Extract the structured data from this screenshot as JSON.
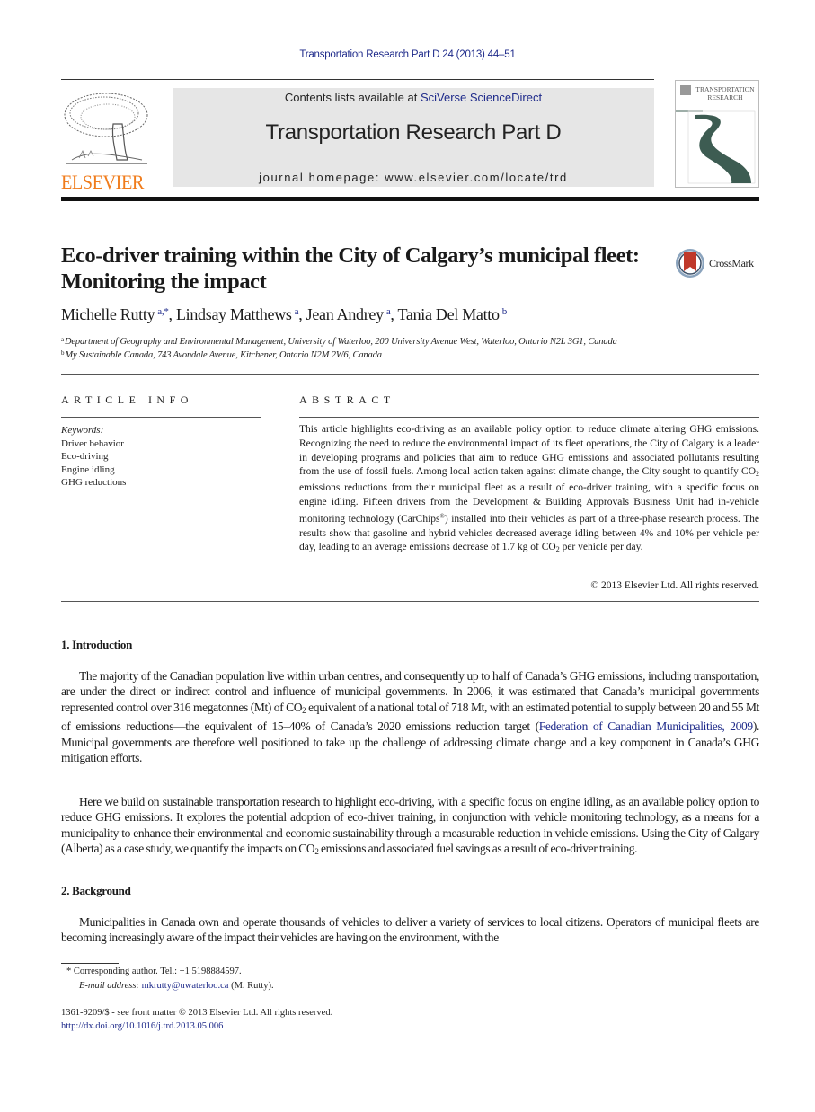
{
  "running_head": "Transportation Research Part D 24 (2013) 44–51",
  "masthead": {
    "publisher_logo_text": "ELSEVIER",
    "contents_prefix": "Contents lists available at ",
    "contents_link": "SciVerse ScienceDirect",
    "journal_title": "Transportation Research Part D",
    "homepage": "journal homepage: www.elsevier.com/locate/trd",
    "cover_title_line1": "TRANSPORTATION",
    "cover_title_line2": "RESEARCH"
  },
  "colors": {
    "link": "#1e2a8a",
    "elsevier_orange": "#f07c1c",
    "masthead_gray": "#e6e6e6",
    "cover_road": "#3d5c52"
  },
  "article": {
    "title_line1": "Eco-driver training within the City of Calgary’s municipal fleet:",
    "title_line2": "Monitoring the impact",
    "crossmark_label": "CrossMark",
    "authors": [
      {
        "name": "Michelle Rutty",
        "sup": "a,*"
      },
      {
        "name": "Lindsay Matthews",
        "sup": "a"
      },
      {
        "name": "Jean Andrey",
        "sup": "a"
      },
      {
        "name": "Tania Del Matto",
        "sup": "b"
      }
    ],
    "affiliations": [
      {
        "key": "a",
        "text": "Department of Geography and Environmental Management, University of Waterloo, 200 University Avenue West, Waterloo, Ontario N2L 3G1, Canada"
      },
      {
        "key": "b",
        "text": "My Sustainable Canada, 743 Avondale Avenue, Kitchener, Ontario N2M 2W6, Canada"
      }
    ]
  },
  "article_info": {
    "label": "ARTICLE INFO",
    "keywords_label": "Keywords:",
    "keywords": [
      "Driver behavior",
      "Eco-driving",
      "Engine idling",
      "GHG reductions"
    ]
  },
  "abstract": {
    "label": "ABSTRACT",
    "part1": "This article highlights eco-driving as an available policy option to reduce climate altering GHG emissions. Recognizing the need to reduce the environmental impact of its fleet operations, the City of Calgary is a leader in developing programs and policies that aim to reduce GHG emissions and associated pollutants resulting from the use of fossil fuels. Among local action taken against climate change, the City sought to quantify CO",
    "part2": " emissions reductions from their municipal fleet as a result of eco-driver training, with a specific focus on engine idling. Fifteen drivers from the Development & Building Approvals Business Unit had in-vehicle monitoring technology (CarChips",
    "part3": ") installed into their vehicles as part of a three-phase research process. The results show that gasoline and hybrid vehicles decreased average idling between 4% and 10% per vehicle per day, leading to an average emissions decrease of 1.7 kg of CO",
    "part4": " per vehicle per day.",
    "sub": "2",
    "reg": "®",
    "copyright": "© 2013 Elsevier Ltd. All rights reserved."
  },
  "sections": {
    "intro_heading": "1. Introduction",
    "intro_p1_a": "The majority of the Canadian population live within urban centres, and consequently up to half of Canada’s GHG emissions, including transportation, are under the direct or indirect control and influence of municipal governments. In 2006, it was estimated that Canada’s municipal governments represented control over 316 megatonnes (Mt) of CO",
    "intro_p1_b": " equivalent of a national total of 718 Mt, with an estimated potential to supply between 20 and 55 Mt of emissions reductions—the equivalent of 15–40% of Canada’s 2020 emissions reduction target (",
    "intro_p1_cite": "Federation of Canadian Municipalities, 2009",
    "intro_p1_c": "). Municipal governments are therefore well positioned to take up the challenge of addressing climate change and a key component in Canada’s GHG mitigation efforts.",
    "intro_p2_a": "Here we build on sustainable transportation research to highlight eco-driving, with a specific focus on engine idling, as an available policy option to reduce GHG emissions. It explores the potential adoption of eco-driver training, in conjunction with vehicle monitoring technology, as a means for a municipality to enhance their environmental and economic sustainability through a measurable reduction in vehicle emissions. Using the City of Calgary (Alberta) as a case study, we quantify the impacts on CO",
    "intro_p2_b": " emissions and associated fuel savings as a result of eco-driver training.",
    "background_heading": "2. Background",
    "background_p1": "Municipalities in Canada own and operate thousands of vehicles to deliver a variety of services to local citizens. Operators of municipal fleets are becoming increasingly aware of the impact their vehicles are having on the environment, with the",
    "sub": "2"
  },
  "footnotes": {
    "corresponding_mark": "*",
    "corresponding": "Corresponding author. Tel.: +1 5198884597.",
    "email_label": "E-mail address:",
    "email": "mkrutty@uwaterloo.ca",
    "email_suffix": " (M. Rutty).",
    "issn": "1361-9209/$ - see front matter © 2013 Elsevier Ltd. All rights reserved.",
    "doi": "http://dx.doi.org/10.1016/j.trd.2013.05.006"
  }
}
